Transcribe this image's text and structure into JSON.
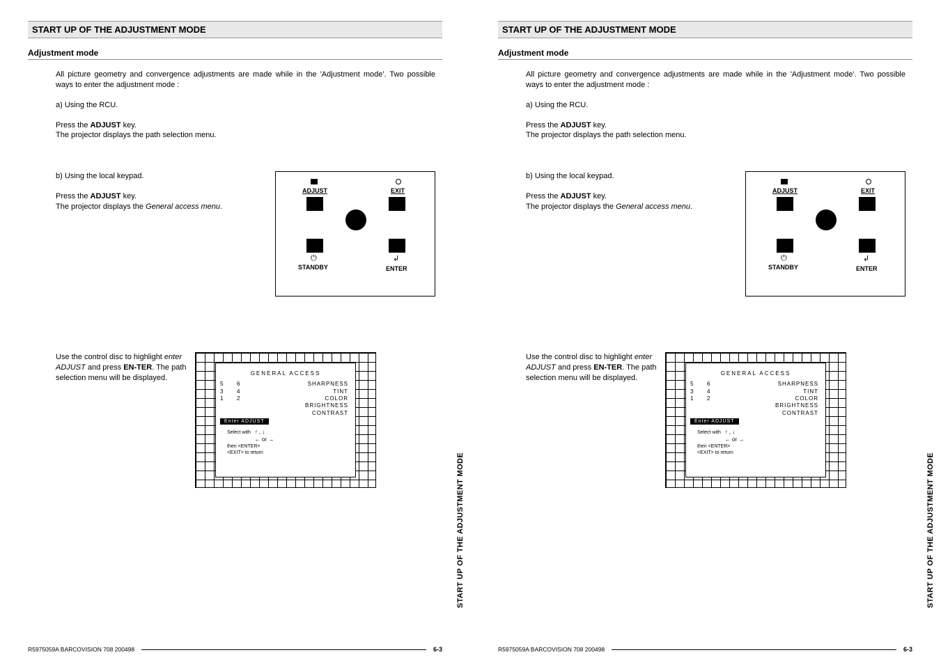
{
  "header": {
    "title": "START UP OF THE ADJUSTMENT MODE"
  },
  "sub": {
    "title": "Adjustment mode"
  },
  "body": {
    "intro": "All picture geometry and convergence adjustments are made while in the 'Adjustment mode'.  Two possible ways to enter the adjustment mode :",
    "a": "a) Using the RCU.",
    "press_prefix": "Press the ",
    "adjust_key": "ADJUST",
    "key_suffix": " key.",
    "path_menu": "The projector displays the path selection menu.",
    "b": "b) Using the local keypad.",
    "general_prefix": "The projector displays the ",
    "general_italic": "General access menu",
    "period": ".",
    "use_disc_1": "Use the control disc to highlight ",
    "use_disc_italic": "enter ADJUST",
    "use_disc_2": " and press ",
    "enter_bold": "EN-TER",
    "use_disc_3": ".  The path selection menu will be displayed."
  },
  "keypad": {
    "adjust": "ADJUST",
    "exit": "EXIT",
    "standby": "STANDBY",
    "enter": "ENTER"
  },
  "osd": {
    "title": "GENERAL ACCESS",
    "left1": [
      "5",
      "3",
      "1"
    ],
    "left2": [
      "6",
      "4",
      "2"
    ],
    "right": [
      "SHARPNESS",
      "TINT",
      "COLOR",
      "BRIGHTNESS",
      "CONTRAST"
    ],
    "highlight": "Enter ADJUST",
    "select": "Select with",
    "arrows1": "↑ , ↓",
    "arrows2": "← or →",
    "then": "then <ENTER>",
    "exit": "<EXIT> to return"
  },
  "side": {
    "text": "START UP OF THE ADJUSTMENT MODE"
  },
  "footer": {
    "doc": "R5975059A BARCOVISION 708 200498",
    "page": "6-3"
  }
}
